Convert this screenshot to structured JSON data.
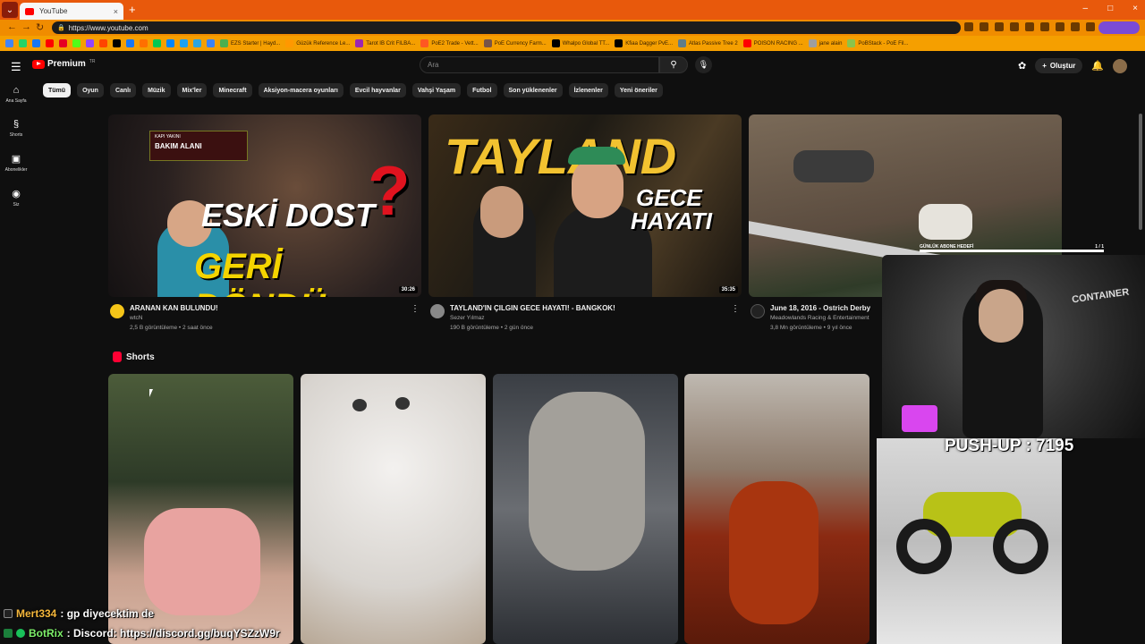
{
  "browser": {
    "tab_title": "YouTube",
    "tab_close": "×",
    "new_tab": "+",
    "url": "https://www.youtube.com",
    "window_controls": [
      "–",
      "□",
      "×"
    ],
    "bookmarks": [
      {
        "label": "",
        "color": "#4285f4"
      },
      {
        "label": "",
        "color": "#25d366"
      },
      {
        "label": "",
        "color": "#1877f2"
      },
      {
        "label": "",
        "color": "#ff0000"
      },
      {
        "label": "",
        "color": "#e60023"
      },
      {
        "label": "",
        "color": "#53fc18"
      },
      {
        "label": "",
        "color": "#9146ff"
      },
      {
        "label": "",
        "color": "#ff4500"
      },
      {
        "label": "",
        "color": "#000000"
      },
      {
        "label": "",
        "color": "#1877f2"
      },
      {
        "label": "",
        "color": "#ff6f00"
      },
      {
        "label": "",
        "color": "#00c853"
      },
      {
        "label": "",
        "color": "#0085ff"
      },
      {
        "label": "",
        "color": "#1da1f2"
      },
      {
        "label": "",
        "color": "#2ca5e0"
      },
      {
        "label": "",
        "color": "#3b82f6"
      },
      {
        "label": "EZS Starter | Hayd...",
        "color": "#4caf50"
      },
      {
        "label": "Güzük Reference Le...",
        "color": "#ff9800"
      },
      {
        "label": "Tarot IB Crit FILBA...",
        "color": "#9c27b0"
      },
      {
        "label": "PoE2 Trade - Vett...",
        "color": "#ff5722"
      },
      {
        "label": "PoE Currency Farm...",
        "color": "#795548"
      },
      {
        "label": "Whalpo Global TT...",
        "color": "#000000"
      },
      {
        "label": "Kfiaa Dagger PvE...",
        "color": "#000000"
      },
      {
        "label": "Atlas Passive Tree 2",
        "color": "#607d8b"
      },
      {
        "label": "POISON RACING ...",
        "color": "#ff0000"
      },
      {
        "label": "jane alain",
        "color": "#9e9e9e"
      },
      {
        "label": "PoBStack - PoE Fil...",
        "color": "#8bc34a"
      }
    ]
  },
  "youtube": {
    "logo_text": "Premium",
    "logo_region": "TR",
    "search_placeholder": "Ara",
    "create_label": "Oluştur",
    "sidebar": [
      {
        "label": "Ana Sayfa",
        "icon": "home-icon",
        "glyph": "⌂"
      },
      {
        "label": "Shorts",
        "icon": "shorts-icon",
        "glyph": "§"
      },
      {
        "label": "Abonelikler",
        "icon": "subscriptions-icon",
        "glyph": "▣"
      },
      {
        "label": "Siz",
        "icon": "you-icon",
        "glyph": "◉"
      }
    ],
    "chips": [
      "Tümü",
      "Oyun",
      "Canlı",
      "Müzik",
      "Mix'ler",
      "Minecraft",
      "Aksiyon-macera oyunları",
      "Evcil hayvanlar",
      "Vahşi Yaşam",
      "Futbol",
      "Son yüklenenler",
      "İzlenenler",
      "Yeni öneriler"
    ],
    "videos": [
      {
        "title": "ARANAN KAN BULUNDU!",
        "channel": "wtcN",
        "stats": "2,5 B görüntüleme • 2 saat önce",
        "duration": "30:26",
        "overlay_1": "ESKİ DOST",
        "overlay_2": "GERİ DÖNDÜ..",
        "overlay_3": "KAPI YAKINI",
        "overlay_4": "BAKIM ALANI",
        "channel_color": "#f5c518"
      },
      {
        "title": "TAYLAND'IN ÇILGIN GECE HAYATI! - BANGKOK!",
        "channel": "Sezer Yılmaz",
        "stats": "190 B görüntüleme • 2 gün önce",
        "duration": "35:35",
        "overlay_1": "TAYLAND",
        "overlay_2": "GECE",
        "overlay_3": "HAYATI",
        "channel_color": "#888888"
      },
      {
        "title": "June 18, 2016 - Ostrich Derby",
        "channel": "Meadowlands Racing & Entertainment",
        "stats": "3,8 Mn görüntüleme • 9 yıl önce",
        "channel_color": "#222222"
      }
    ],
    "shorts_label": "Shorts"
  },
  "stream_overlay": {
    "pushup": "PUSH-UP : 7195",
    "derby_left": "GÜNLÜK ABONE HEDEFİ",
    "derby_right": "1 / 1",
    "cam_text": "CONTAINER",
    "chat": [
      {
        "user": "Mert334",
        "message": ": gp diyecektim de"
      },
      {
        "user": "BotRix",
        "message": ": Discord: https://discord.gg/buqYSZzW9r"
      }
    ]
  }
}
